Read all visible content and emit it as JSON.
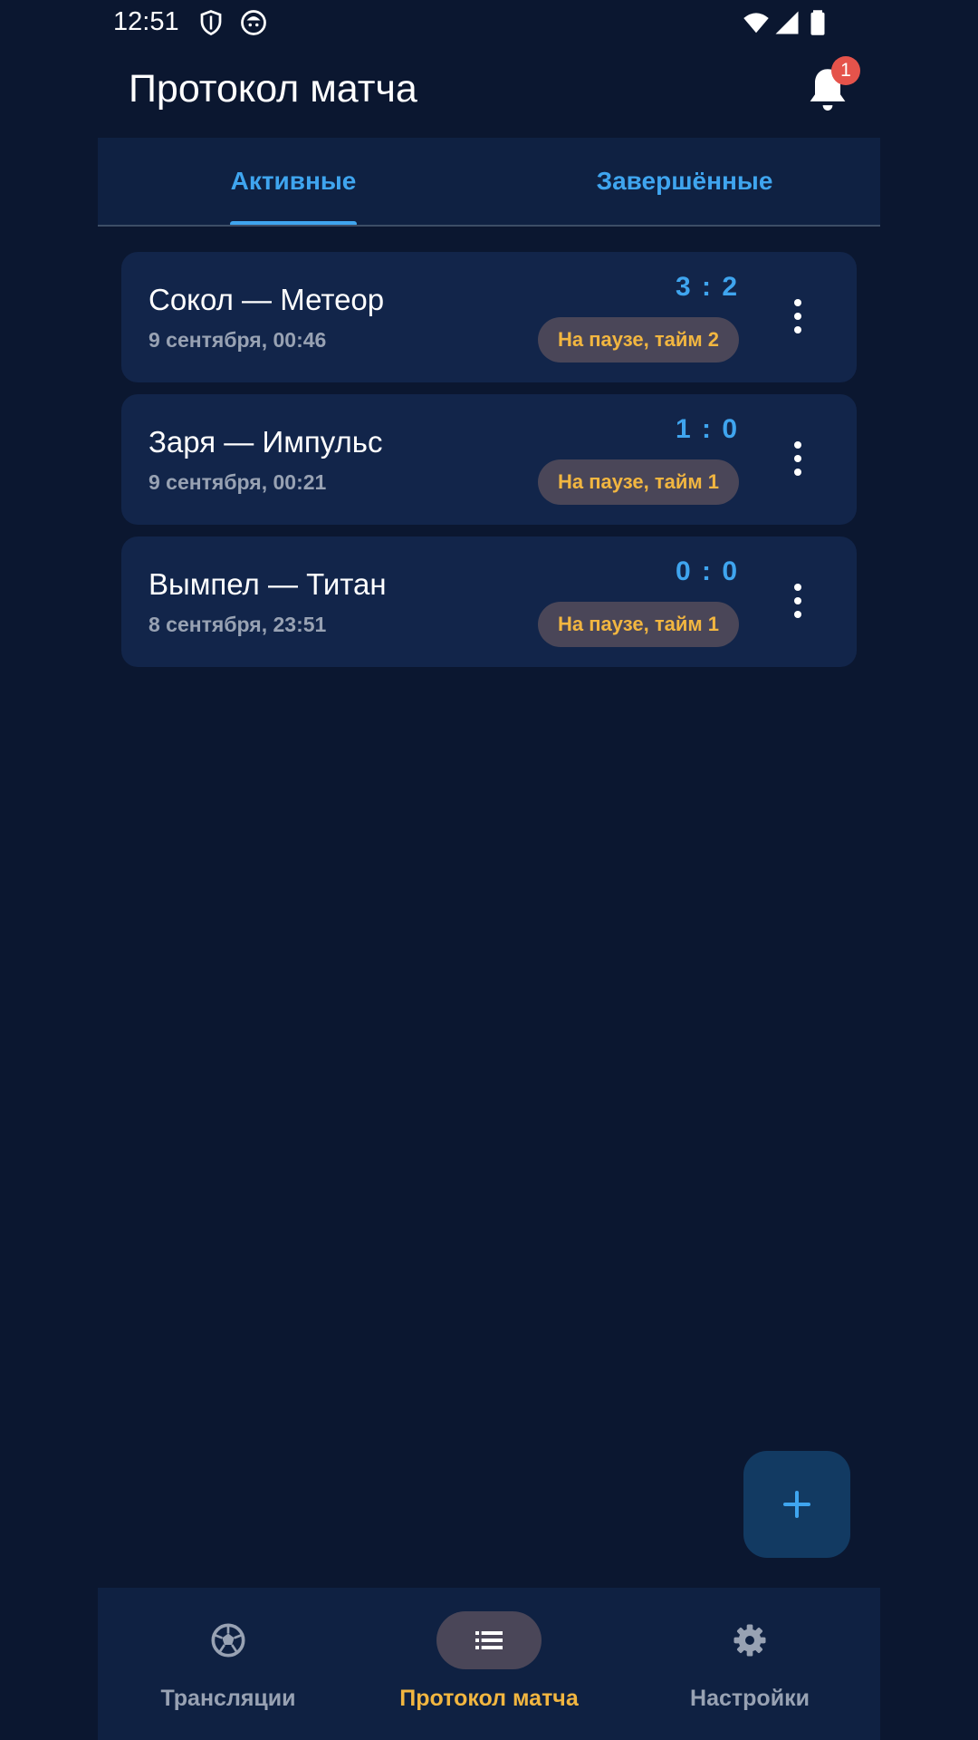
{
  "status_bar": {
    "time": "12:51"
  },
  "header": {
    "title": "Протокол матча",
    "notification_count": "1"
  },
  "tabs": [
    {
      "label": "Активные"
    },
    {
      "label": "Завершённые"
    }
  ],
  "matches": [
    {
      "title": "Сокол — Метеор",
      "date": "9 сентября, 00:46",
      "score": "3 : 2",
      "status": "На паузе, тайм 2"
    },
    {
      "title": "Заря — Импульс",
      "date": "9 сентября, 00:21",
      "score": "1 : 0",
      "status": "На паузе, тайм 1"
    },
    {
      "title": "Вымпел — Титан",
      "date": "8 сентября, 23:51",
      "score": "0 : 0",
      "status": "На паузе, тайм 1"
    }
  ],
  "fab": {
    "icon": "plus-icon"
  },
  "bottom_nav": [
    {
      "label": "Трансляции",
      "icon": "soccer-ball-icon",
      "active": false
    },
    {
      "label": "Протокол матча",
      "icon": "list-icon",
      "active": true
    },
    {
      "label": "Настройки",
      "icon": "gear-icon",
      "active": false
    }
  ],
  "colors": {
    "background": "#0b1730",
    "card": "#12254a",
    "accent_blue": "#3fa5ef",
    "accent_yellow": "#f2b640",
    "badge_red": "#e5534b"
  }
}
